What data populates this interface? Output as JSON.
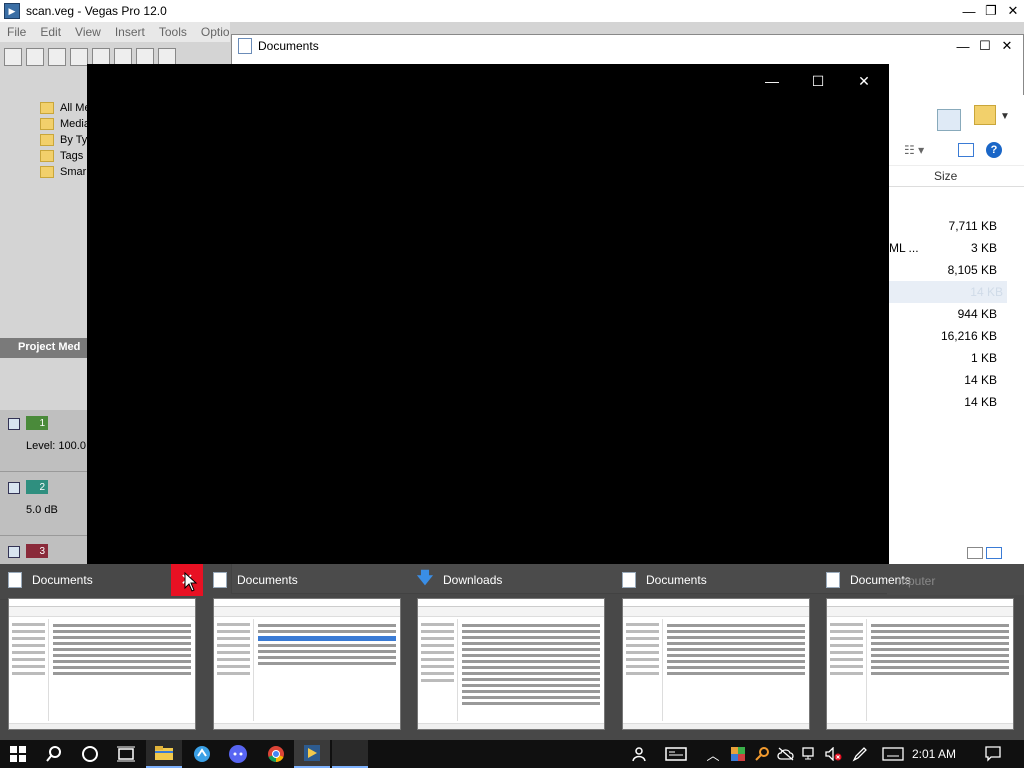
{
  "vegas": {
    "title": "scan.veg - Vegas Pro 12.0",
    "menu": [
      "File",
      "Edit",
      "View",
      "Insert",
      "Tools",
      "Optio"
    ],
    "media_tree": [
      "All Me",
      "Media",
      "By Ty",
      "Tags",
      "Smar"
    ],
    "project_media_label": "Project Med",
    "tracks": [
      {
        "num": "1",
        "label": "Level: 100.0",
        "color": "#4a8a3a"
      },
      {
        "num": "2",
        "label": "5.0 dB",
        "color": "#2f8f7f"
      },
      {
        "num": "3",
        "label": "",
        "color": "#8a2a3a"
      }
    ]
  },
  "documents_window": {
    "title": "Documents",
    "size_header": "Size",
    "xml_fragment": "ML ...",
    "sizes": [
      "7,711 KB",
      "3 KB",
      "8,105 KB",
      "",
      "944 KB",
      "16,216 KB",
      "1 KB",
      "14 KB",
      "14 KB"
    ],
    "highlight_size": "14 KB",
    "computer_fragment": "mputer"
  },
  "player_window": {
    "minimize": "—",
    "maximize": "☐",
    "close": "✕"
  },
  "previews": [
    {
      "title": "Documents",
      "icon": "document-folder-icon",
      "close": "✕"
    },
    {
      "title": "Documents",
      "icon": "document-folder-icon"
    },
    {
      "title": "Downloads",
      "icon": "download-arrow-icon",
      "glyph": "🡇"
    },
    {
      "title": "Documents",
      "icon": "document-folder-icon"
    },
    {
      "title": "Documents",
      "icon": "document-folder-icon"
    }
  ],
  "taskbar": {
    "clock": "2:01 AM",
    "start_icon": "windows-start-icon",
    "search_icon": "search-icon",
    "cortana_icon": "cortana-circle-icon",
    "taskview_icon": "task-view-icon"
  },
  "colors": {
    "close_red": "#e81123",
    "taskbar_bg": "#101010",
    "accent": "#7fb3ff"
  }
}
